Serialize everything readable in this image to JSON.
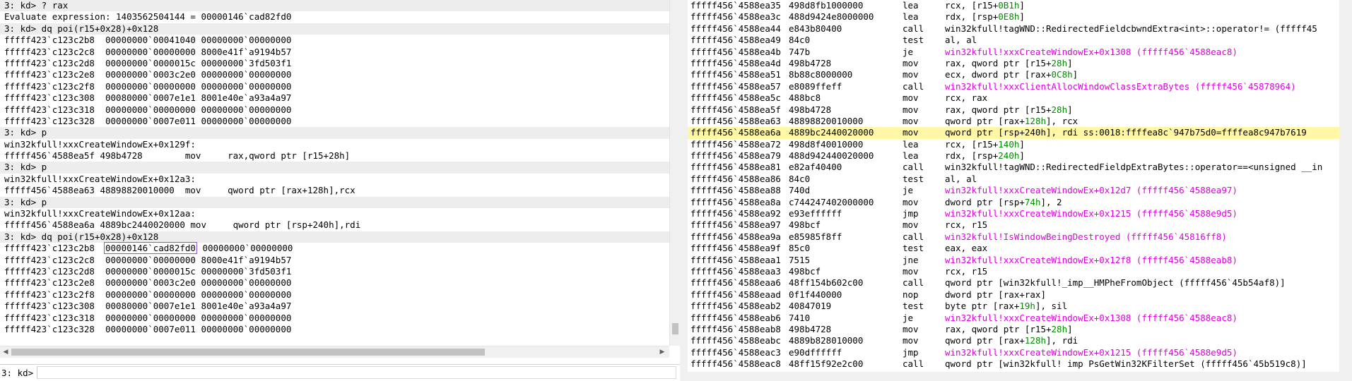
{
  "left": {
    "lines": [
      {
        "text": "3: kd> ? rax",
        "prompt": true
      },
      {
        "text": "Evaluate expression: 1403562504144 = 00000146`cad82fd0"
      },
      {
        "text": "3: kd> dq poi(r15+0x28)+0x128",
        "prompt": true
      },
      {
        "text": "fffff423`c123c2b8  00000000`00041040 00000000`00000000"
      },
      {
        "text": "fffff423`c123c2c8  00000000`00000000 8000e41f`a9194b57"
      },
      {
        "text": "fffff423`c123c2d8  00000000`0000015c 00000000`3fd503f1"
      },
      {
        "text": "fffff423`c123c2e8  00000000`0003c2e0 00000000`00000000"
      },
      {
        "text": "fffff423`c123c2f8  00000000`00000000 00000000`00000000"
      },
      {
        "text": "fffff423`c123c308  00080000`0007e1e1 8001e40e`a93a4a97"
      },
      {
        "text": "fffff423`c123c318  00000000`00000000 00000000`00000000"
      },
      {
        "text": "fffff423`c123c328  00000000`0007e011 00000000`00000000"
      },
      {
        "text": "3: kd> p",
        "prompt": true
      },
      {
        "text": "win32kfull!xxxCreateWindowEx+0x129f:"
      },
      {
        "text": "fffff456`4588ea5f 498b4728        mov     rax,qword ptr [r15+28h]"
      },
      {
        "text": "3: kd> p",
        "prompt": true
      },
      {
        "text": "win32kfull!xxxCreateWindowEx+0x12a3:"
      },
      {
        "text": "fffff456`4588ea63 48898820010000  mov     qword ptr [rax+128h],rcx"
      },
      {
        "text": "3: kd> p",
        "prompt": true
      },
      {
        "text": "win32kfull!xxxCreateWindowEx+0x12aa:"
      },
      {
        "text": "fffff456`4588ea6a 4889bc2440020000 mov     qword ptr [rsp+240h],rdi"
      },
      {
        "text": "3: kd> dq poi(r15+0x28)+0x128",
        "prompt": true
      },
      {
        "pre": "fffff423`c123c2b8  ",
        "box": "00000146`cad82fd0",
        "post": " 00000000`00000000"
      },
      {
        "text": "fffff423`c123c2c8  00000000`00000000 8000e41f`a9194b57"
      },
      {
        "text": "fffff423`c123c2d8  00000000`0000015c 00000000`3fd503f1"
      },
      {
        "text": "fffff423`c123c2e8  00000000`0003c2e0 00000000`00000000"
      },
      {
        "text": "fffff423`c123c2f8  00000000`00000000 00000000`00000000"
      },
      {
        "text": "fffff423`c123c308  00080000`0007e1e1 8001e40e`a93a4a97"
      },
      {
        "text": "fffff423`c123c318  00000000`00000000 00000000`00000000"
      },
      {
        "text": "fffff423`c123c328  00000000`0007e011 00000000`00000000"
      }
    ],
    "command_prompt": "3: kd>",
    "command_value": ""
  },
  "right": {
    "rows": [
      {
        "addr": "fffff456`4588ea35",
        "bytes": "498d8fb1000000",
        "mn": "lea",
        "op": [
          {
            "t": "rcx, [r15+"
          },
          {
            "t": "0B1h",
            "c": "grn"
          },
          {
            "t": "]"
          }
        ]
      },
      {
        "addr": "fffff456`4588ea3c",
        "bytes": "488d9424e8000000",
        "mn": "lea",
        "op": [
          {
            "t": "rdx, [rsp+"
          },
          {
            "t": "0E8h",
            "c": "grn"
          },
          {
            "t": "]"
          }
        ]
      },
      {
        "addr": "fffff456`4588ea44",
        "bytes": "e843b80400",
        "mn": "call",
        "op": [
          {
            "t": "win32kfull!tagWND::RedirectedFieldcbwndExtra<int>::operator!= (fffff45"
          }
        ]
      },
      {
        "addr": "fffff456`4588ea49",
        "bytes": "84c0",
        "mn": "test",
        "op": [
          {
            "t": "al, al"
          }
        ]
      },
      {
        "addr": "fffff456`4588ea4b",
        "bytes": "747b",
        "mn": "je",
        "op": [
          {
            "t": "win32kfull!xxxCreateWindowEx+0x1308 (fffff456`4588eac8)",
            "c": "mag"
          }
        ]
      },
      {
        "addr": "fffff456`4588ea4d",
        "bytes": "498b4728",
        "mn": "mov",
        "op": [
          {
            "t": "rax, qword ptr [r15+"
          },
          {
            "t": "28h",
            "c": "grn"
          },
          {
            "t": "]"
          }
        ]
      },
      {
        "addr": "fffff456`4588ea51",
        "bytes": "8b88c8000000",
        "mn": "mov",
        "op": [
          {
            "t": "ecx, dword ptr [rax+"
          },
          {
            "t": "0C8h",
            "c": "grn"
          },
          {
            "t": "]"
          }
        ]
      },
      {
        "addr": "fffff456`4588ea57",
        "bytes": "e8089ffeff",
        "mn": "call",
        "op": [
          {
            "t": "win32kfull!xxxClientAllocWindowClassExtraBytes (fffff456`45878964)",
            "c": "mag"
          }
        ]
      },
      {
        "addr": "fffff456`4588ea5c",
        "bytes": "488bc8",
        "mn": "mov",
        "op": [
          {
            "t": "rcx, rax"
          }
        ]
      },
      {
        "addr": "fffff456`4588ea5f",
        "bytes": "498b4728",
        "mn": "mov",
        "op": [
          {
            "t": "rax, qword ptr [r15+"
          },
          {
            "t": "28h",
            "c": "grn"
          },
          {
            "t": "]"
          }
        ]
      },
      {
        "addr": "fffff456`4588ea63",
        "bytes": "48898820010000",
        "mn": "mov",
        "op": [
          {
            "t": "qword ptr [rax+"
          },
          {
            "t": "128h",
            "c": "grn"
          },
          {
            "t": "], rcx"
          }
        ]
      },
      {
        "addr": "fffff456`4588ea6a",
        "bytes": "4889bc2440020000",
        "mn": "mov",
        "cur": true,
        "op": [
          {
            "t": "qword ptr [rsp+240h], rdi ss:0018:ffffea8c`947b75d0=ffffea8c947b7619"
          }
        ]
      },
      {
        "addr": "fffff456`4588ea72",
        "bytes": "498d8f40010000",
        "mn": "lea",
        "op": [
          {
            "t": "rcx, [r15+"
          },
          {
            "t": "140h",
            "c": "grn"
          },
          {
            "t": "]"
          }
        ]
      },
      {
        "addr": "fffff456`4588ea79",
        "bytes": "488d942440020000",
        "mn": "lea",
        "op": [
          {
            "t": "rdx, [rsp+"
          },
          {
            "t": "240h",
            "c": "grn"
          },
          {
            "t": "]"
          }
        ]
      },
      {
        "addr": "fffff456`4588ea81",
        "bytes": "e82af40400",
        "mn": "call",
        "op": [
          {
            "t": "win32kfull!tagWND::RedirectedFieldpExtraBytes::operator==<unsigned __in"
          }
        ]
      },
      {
        "addr": "fffff456`4588ea86",
        "bytes": "84c0",
        "mn": "test",
        "op": [
          {
            "t": "al, al"
          }
        ]
      },
      {
        "addr": "fffff456`4588ea88",
        "bytes": "740d",
        "mn": "je",
        "op": [
          {
            "t": "win32kfull!xxxCreateWindowEx+0x12d7 (fffff456`4588ea97)",
            "c": "mag"
          }
        ]
      },
      {
        "addr": "fffff456`4588ea8a",
        "bytes": "c744247402000000",
        "mn": "mov",
        "op": [
          {
            "t": "dword ptr [rsp+"
          },
          {
            "t": "74h",
            "c": "grn"
          },
          {
            "t": "], 2"
          }
        ]
      },
      {
        "addr": "fffff456`4588ea92",
        "bytes": "e93effffff",
        "mn": "jmp",
        "op": [
          {
            "t": "win32kfull!xxxCreateWindowEx+0x1215 (fffff456`4588e9d5)",
            "c": "mag"
          }
        ]
      },
      {
        "addr": "fffff456`4588ea97",
        "bytes": "498bcf",
        "mn": "mov",
        "op": [
          {
            "t": "rcx, r15"
          }
        ]
      },
      {
        "addr": "fffff456`4588ea9a",
        "bytes": "e85985f8ff",
        "mn": "call",
        "op": [
          {
            "t": "win32kfull!IsWindowBeingDestroyed (fffff456`45816ff8)",
            "c": "mag"
          }
        ]
      },
      {
        "addr": "fffff456`4588ea9f",
        "bytes": "85c0",
        "mn": "test",
        "op": [
          {
            "t": "eax, eax"
          }
        ]
      },
      {
        "addr": "fffff456`4588eaa1",
        "bytes": "7515",
        "mn": "jne",
        "op": [
          {
            "t": "win32kfull!xxxCreateWindowEx+0x12f8 (fffff456`4588eab8)",
            "c": "mag"
          }
        ]
      },
      {
        "addr": "fffff456`4588eaa3",
        "bytes": "498bcf",
        "mn": "mov",
        "op": [
          {
            "t": "rcx, r15"
          }
        ]
      },
      {
        "addr": "fffff456`4588eaa6",
        "bytes": "48ff154b602c00",
        "mn": "call",
        "op": [
          {
            "t": "qword ptr [win32kfull!_imp__HMPheFromObject (fffff456`45b54af8)]"
          }
        ]
      },
      {
        "addr": "fffff456`4588eaad",
        "bytes": "0f1f440000",
        "mn": "nop",
        "op": [
          {
            "t": "dword ptr [rax+rax]"
          }
        ]
      },
      {
        "addr": "fffff456`4588eab2",
        "bytes": "40847019",
        "mn": "test",
        "op": [
          {
            "t": "byte ptr [rax+"
          },
          {
            "t": "19h",
            "c": "grn"
          },
          {
            "t": "], sil"
          }
        ]
      },
      {
        "addr": "fffff456`4588eab6",
        "bytes": "7410",
        "mn": "je",
        "op": [
          {
            "t": "win32kfull!xxxCreateWindowEx+0x1308 (fffff456`4588eac8)",
            "c": "mag"
          }
        ]
      },
      {
        "addr": "fffff456`4588eab8",
        "bytes": "498b4728",
        "mn": "mov",
        "op": [
          {
            "t": "rax, qword ptr [r15+"
          },
          {
            "t": "28h",
            "c": "grn"
          },
          {
            "t": "]"
          }
        ]
      },
      {
        "addr": "fffff456`4588eabc",
        "bytes": "4889b828010000",
        "mn": "mov",
        "op": [
          {
            "t": "qword ptr [rax+"
          },
          {
            "t": "128h",
            "c": "grn"
          },
          {
            "t": "], rdi"
          }
        ]
      },
      {
        "addr": "fffff456`4588eac3",
        "bytes": "e90dffffff",
        "mn": "jmp",
        "op": [
          {
            "t": "win32kfull!xxxCreateWindowEx+0x1215 (fffff456`4588e9d5)",
            "c": "mag"
          }
        ]
      },
      {
        "addr": "fffff456`4588eac8",
        "bytes": "48ff15f92e2c00",
        "mn": "call",
        "op": [
          {
            "t": "qword ptr [win32kfull! imp PsGetWin32KFilterSet (fffff456`45b519c8)]"
          }
        ]
      }
    ]
  }
}
